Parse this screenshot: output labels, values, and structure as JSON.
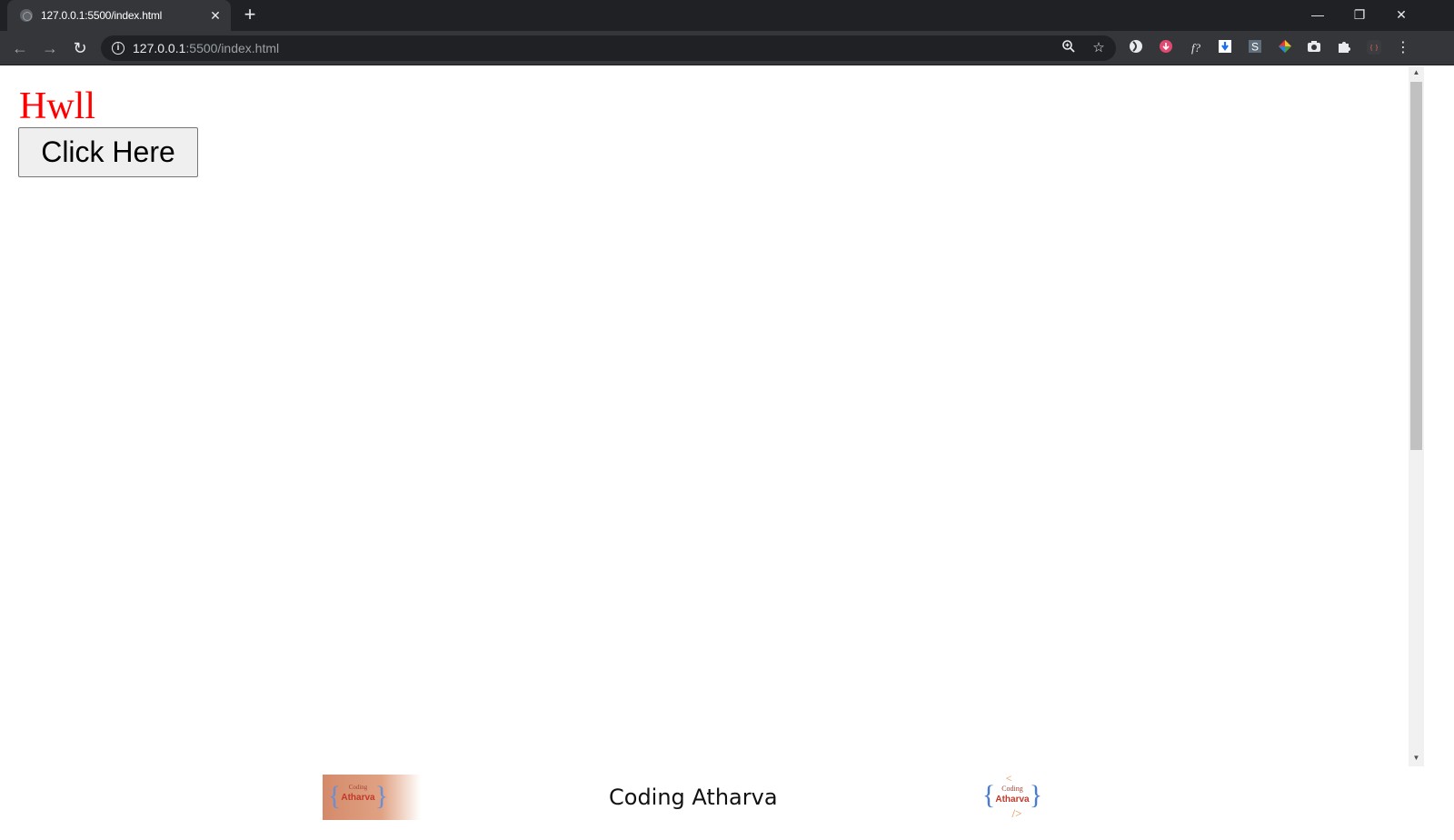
{
  "browser": {
    "tab_title": "127.0.0.1:5500/index.html",
    "tab_close": "✕",
    "new_tab": "+",
    "url_host": "127.0.0.1",
    "url_path": ":5500/index.html",
    "window": {
      "minimize": "—",
      "restore": "❐",
      "close": "✕"
    },
    "nav": {
      "back": "←",
      "forward": "→",
      "reload": "↻"
    }
  },
  "page": {
    "heading": "Hwll",
    "button_label": "Click Here",
    "heading_color": "#ff0000"
  },
  "footer": {
    "title": "Coding Atharva",
    "logo_small_text": "Coding",
    "logo_main_text": "Atharva"
  },
  "icons": [
    "zoom-icon",
    "star-icon",
    "extension-icons",
    "puzzle-icon",
    "menu-icon"
  ]
}
